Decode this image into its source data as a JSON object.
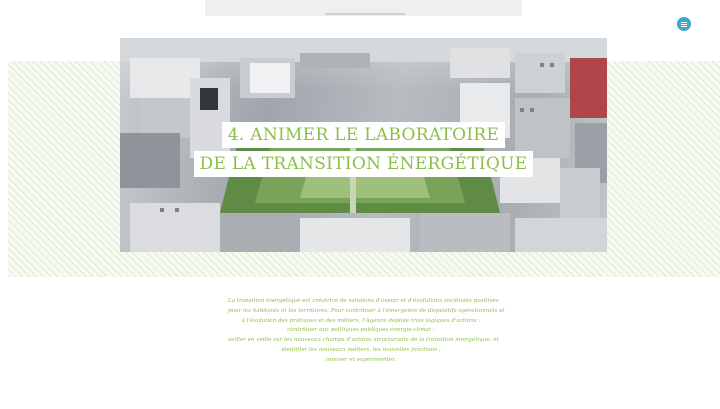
{
  "header": {
    "menu_icon": "menu-icon",
    "accent_color": "#3fa9c9"
  },
  "hero": {
    "title_line1": "4. ANIMER LE LABORATOIRE",
    "title_line2": "DE LA TRANSITION ÉNERGÉTIQUE",
    "title_color": "#8cbf4a"
  },
  "intro": {
    "lines": [
      "La transition énergétique est créatrice de solutions d'avenir et d'évolutions sociétales positives",
      "pour les habitants et les territoires. Pour contribuer à l'émergence de dispositifs opérationnels et",
      "à l'évolution des pratiques et des métiers, l'Agence déploie trois logiques d'actions :",
      "contribuer aux politiques publiques énergie-climat ;",
      "veiller en veille sur les nouveaux champs d'actions structurants de la transition énergétique, et",
      "identifier les nouveaux métiers, les nouvelles fonctions ;",
      "innover et expérimenter."
    ]
  }
}
